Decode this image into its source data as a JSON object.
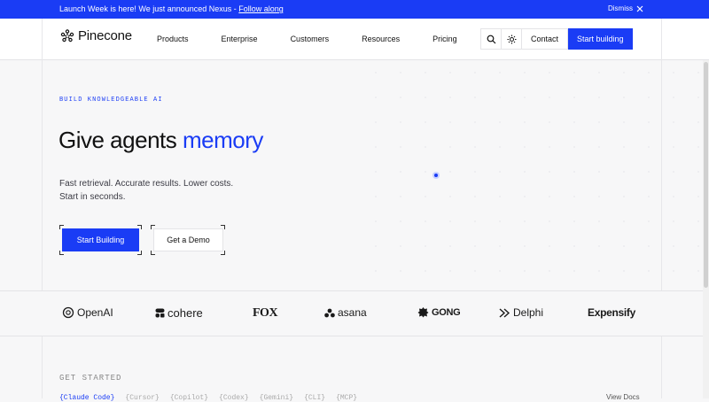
{
  "banner": {
    "message": "Launch Week is here! We just announced Nexus - ",
    "link": "Follow along",
    "dismiss": "Dismiss"
  },
  "nav": {
    "brand": "Pinecone",
    "links": [
      "Products",
      "Enterprise",
      "Customers",
      "Resources",
      "Pricing"
    ],
    "contact": "Contact",
    "cta": "Start building"
  },
  "hero": {
    "eyebrow": "BUILD KNOWLEDGEABLE AI",
    "headline_plain": "Give agents ",
    "headline_accent": "memory",
    "sub_line1": "Fast retrieval. Accurate results. Lower costs.",
    "sub_line2": "Start in seconds.",
    "primary_button": "Start Building",
    "secondary_button": "Get a Demo"
  },
  "logos": [
    "OpenAI",
    "cohere",
    "FOX",
    "asana",
    "GONG",
    "Delphi",
    "Expensify"
  ],
  "get_started": {
    "heading": "GET STARTED",
    "tabs": [
      "{Claude Code}",
      "{Cursor}",
      "{Copilot}",
      "{Codex}",
      "{Gemini}",
      "{CLI}",
      "{MCP}"
    ],
    "view_docs": "View Docs"
  },
  "colors": {
    "brand_blue": "#1a3cf5",
    "background": "#f7f7f8"
  }
}
